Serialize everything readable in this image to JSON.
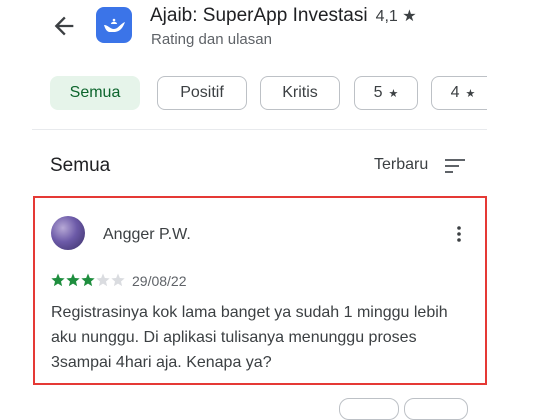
{
  "header": {
    "app_name": "Ajaib: SuperApp Investasi",
    "rating": "4,1 ★",
    "subtitle": "Rating dan ulasan"
  },
  "filters": [
    "Semua",
    "Positif",
    "Kritis",
    "5",
    "4"
  ],
  "section": {
    "title": "Semua",
    "sort_label": "Terbaru"
  },
  "review": {
    "reviewer": "Angger P.W.",
    "stars_filled": 3,
    "stars_total": 5,
    "date": "29/08/22",
    "text": "Registrasinya kok lama banget ya sudah 1 minggu lebih aku nunggu. Di aplikasi tulisanya menunggu proses 3sampai 4hari aja. Kenapa ya?"
  },
  "colors": {
    "accent": "#1e8e3e",
    "selected_chip_bg": "#e6f4ea",
    "highlight_border": "#e53935",
    "app_icon": "#3b74e8"
  }
}
